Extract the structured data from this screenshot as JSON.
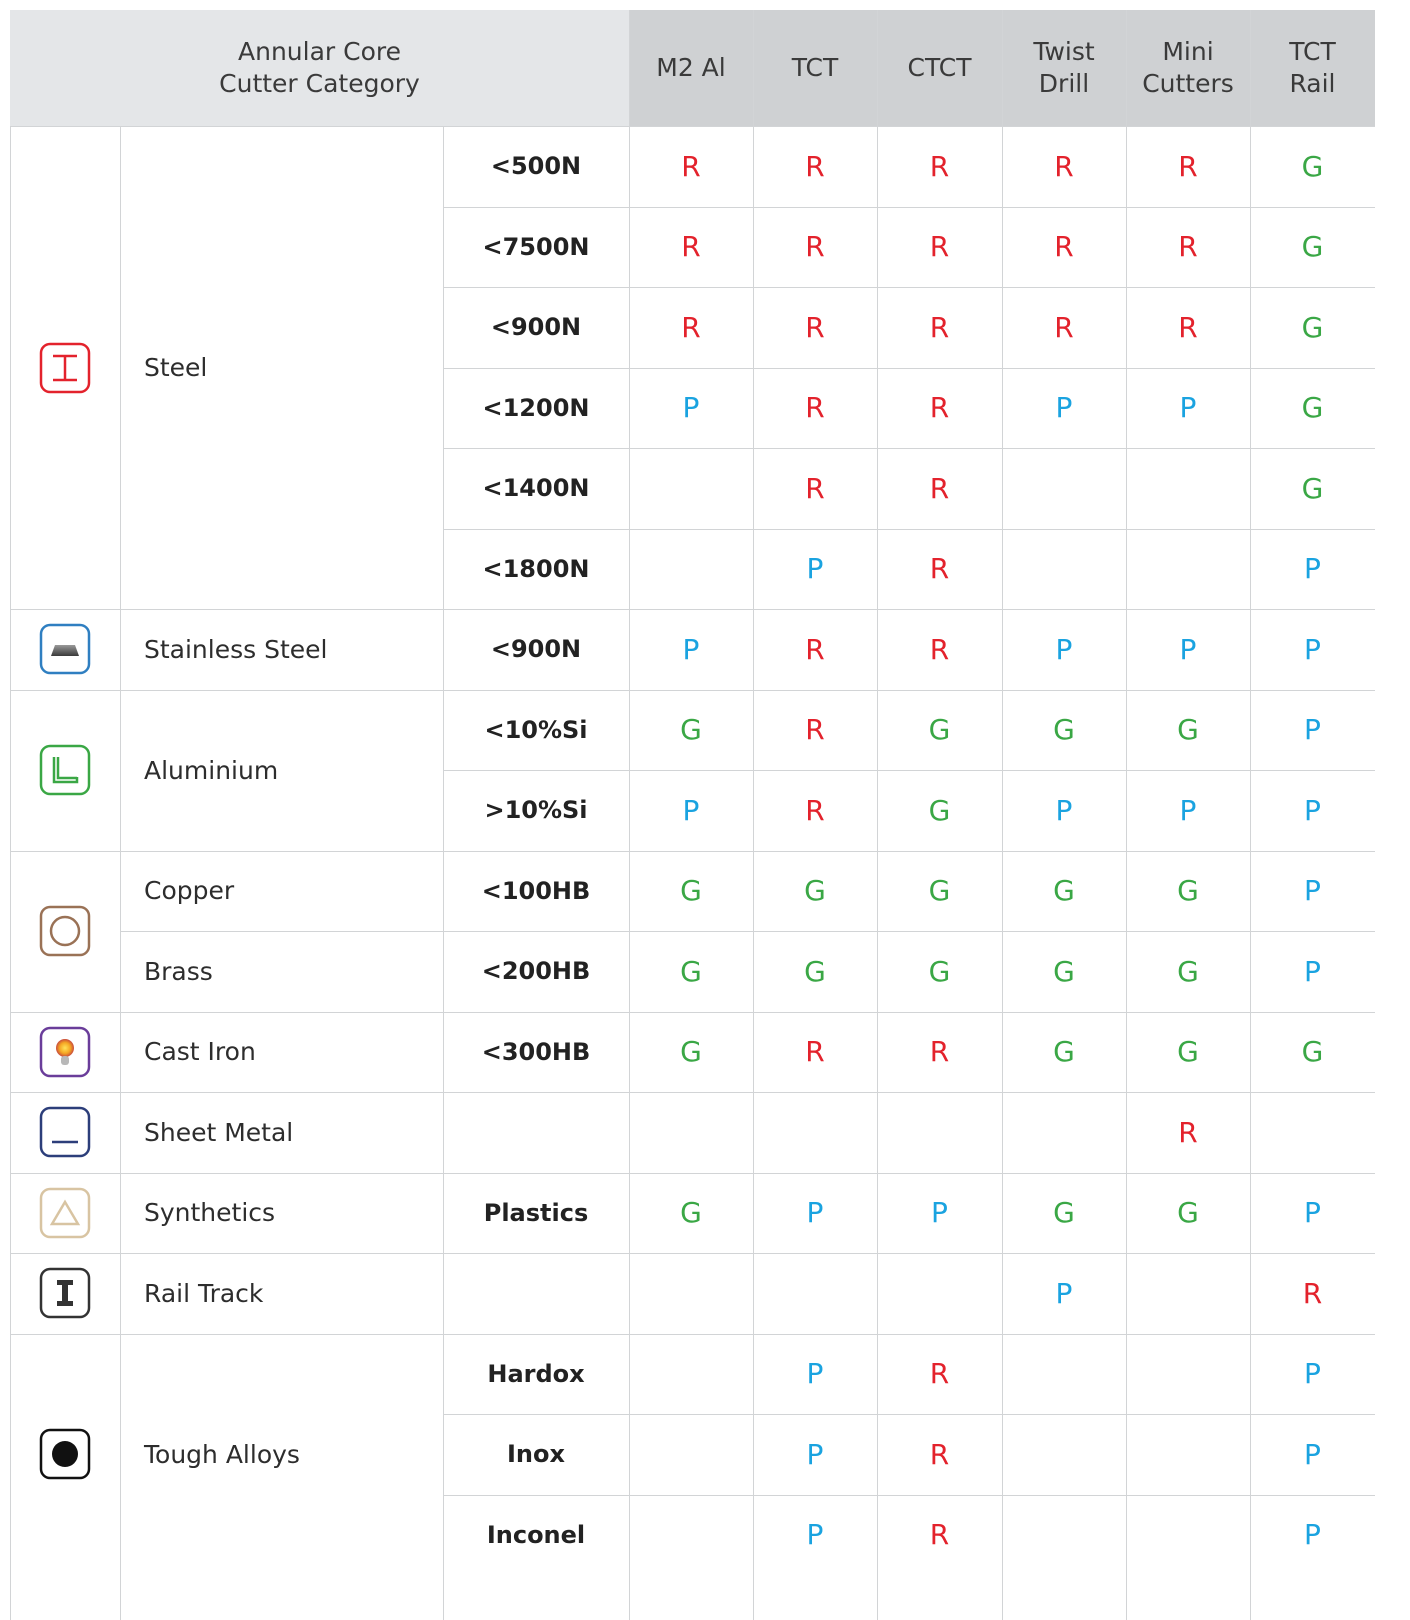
{
  "header": {
    "category_title": "Annular Core\nCutter Category",
    "columns": [
      "M2 Al",
      "TCT",
      "CTCT",
      "Twist\nDrill",
      "Mini\nCutters",
      "TCT\nRail"
    ]
  },
  "colors": {
    "R": "#e3222c",
    "G": "#3aa745",
    "P": "#1aa3e0"
  },
  "materials": [
    {
      "name": "Steel",
      "icon": "steel-beam-icon",
      "icon_color": "#e3222c",
      "rows": [
        {
          "spec": "<500N",
          "grades": [
            "R",
            "R",
            "R",
            "R",
            "R",
            "G"
          ]
        },
        {
          "spec": "<7500N",
          "grades": [
            "R",
            "R",
            "R",
            "R",
            "R",
            "G"
          ]
        },
        {
          "spec": "<900N",
          "grades": [
            "R",
            "R",
            "R",
            "R",
            "R",
            "G"
          ]
        },
        {
          "spec": "<1200N",
          "grades": [
            "P",
            "R",
            "R",
            "P",
            "P",
            "G"
          ]
        },
        {
          "spec": "<1400N",
          "grades": [
            "",
            "R",
            "R",
            "",
            "",
            "G"
          ]
        },
        {
          "spec": "<1800N",
          "grades": [
            "",
            "P",
            "R",
            "",
            "",
            "P"
          ]
        }
      ]
    },
    {
      "name": "Stainless Steel",
      "icon": "stainless-plate-icon",
      "icon_color": "#2f7fc1",
      "rows": [
        {
          "spec": "<900N",
          "grades": [
            "P",
            "R",
            "R",
            "P",
            "P",
            "P"
          ]
        }
      ]
    },
    {
      "name": "Aluminium",
      "icon": "aluminium-profile-icon",
      "icon_color": "#3aa745",
      "rows": [
        {
          "spec": "<10%Si",
          "grades": [
            "G",
            "R",
            "G",
            "G",
            "G",
            "P"
          ]
        },
        {
          "spec": ">10%Si",
          "grades": [
            "P",
            "R",
            "G",
            "P",
            "P",
            "P"
          ]
        }
      ]
    },
    {
      "name": "Copper",
      "icon": "copper-brass-ring-icon",
      "icon_color": "#9a7256",
      "rows": [
        {
          "spec": "<100HB",
          "grades": [
            "G",
            "G",
            "G",
            "G",
            "G",
            "P"
          ]
        }
      ]
    },
    {
      "name": "Brass",
      "icon": "",
      "rows": [
        {
          "spec": "<200HB",
          "grades": [
            "G",
            "G",
            "G",
            "G",
            "G",
            "P"
          ]
        }
      ]
    },
    {
      "name": "Cast Iron",
      "icon": "cast-iron-bulb-icon",
      "icon_color": "#6a3d9a",
      "rows": [
        {
          "spec": "<300HB",
          "grades": [
            "G",
            "R",
            "R",
            "G",
            "G",
            "G"
          ]
        }
      ]
    },
    {
      "name": "Sheet Metal",
      "icon": "sheet-metal-icon",
      "icon_color": "#2c3e7a",
      "rows": [
        {
          "spec": "",
          "grades": [
            "",
            "",
            "",
            "",
            "R",
            ""
          ]
        }
      ]
    },
    {
      "name": "Synthetics",
      "icon": "synthetics-triangle-icon",
      "icon_color": "#d8c4a2",
      "rows": [
        {
          "spec": "Plastics",
          "grades": [
            "G",
            "P",
            "P",
            "G",
            "G",
            "P"
          ]
        }
      ]
    },
    {
      "name": "Rail Track",
      "icon": "rail-track-icon",
      "icon_color": "#333333",
      "rows": [
        {
          "spec": "",
          "grades": [
            "",
            "",
            "",
            "P",
            "",
            "R"
          ]
        }
      ]
    },
    {
      "name": "Tough Alloys",
      "icon": "tough-alloy-icon",
      "icon_color": "#111111",
      "rows": [
        {
          "spec": "Hardox",
          "grades": [
            "",
            "P",
            "R",
            "",
            "",
            "P"
          ]
        },
        {
          "spec": "Inox",
          "grades": [
            "",
            "P",
            "R",
            "",
            "",
            "P"
          ]
        },
        {
          "spec": "Inconel",
          "grades": [
            "",
            "P",
            "R",
            "",
            "",
            "P"
          ]
        }
      ]
    }
  ]
}
